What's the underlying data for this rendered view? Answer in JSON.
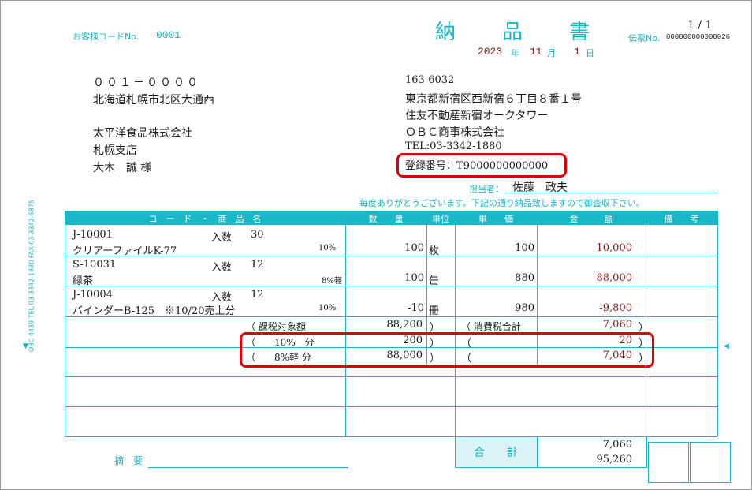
{
  "header": {
    "customer_code_label": "お客様コードNo.",
    "customer_code": "0001",
    "title_chars": [
      "納",
      "品",
      "書"
    ],
    "page": "1 / 1",
    "slip_label": "伝票No.",
    "slip_no": "000000000000026",
    "date_year": "2023",
    "date_year_unit": "年",
    "date_month": "11",
    "date_month_unit": "月",
    "date_day": "1",
    "date_day_unit": "日"
  },
  "recipient": {
    "zip": "００１－００００",
    "address": "北海道札幌市北区大通西",
    "company": "太平洋食品株式会社",
    "branch": "札幌支店",
    "person": "大木　誠 様"
  },
  "sender": {
    "zip": "163-6032",
    "address1": "東京都新宿区西新宿６丁目８番１号",
    "address2": "住友不動産新宿オークタワー",
    "company": "ＯＢＣ商事株式会社",
    "tel": "TEL:03-3342-1880",
    "registration": "登録番号：T9000000000000",
    "staff_label": "担当者：",
    "staff": "佐藤　政夫",
    "greeting": "毎度ありがとうございます。下記の通り納品致しますので御査収下さい。"
  },
  "table": {
    "headers": {
      "code_name": "コ　ー　ド　・　商　品　名",
      "qty": "数　　量",
      "unit": "単位",
      "price": "単　　価",
      "amount": "金　　　額",
      "note": "備　　考"
    },
    "items": [
      {
        "code": "J-10001",
        "qty_in_label": "入数",
        "qty_in": "30",
        "name": "クリアーファイルK-77",
        "tax": "10%",
        "qty": "100",
        "unit": "枚",
        "price": "100",
        "amount": "10,000"
      },
      {
        "code": "S-10031",
        "qty_in_label": "入数",
        "qty_in": "12",
        "name": "緑茶",
        "tax": "8%軽",
        "qty": "100",
        "unit": "缶",
        "price": "880",
        "amount": "88,000"
      },
      {
        "code": "J-10004",
        "qty_in_label": "入数",
        "qty_in": "12",
        "name": "バインダーB-125　※10/20売上分",
        "tax": "10%",
        "qty": "-10",
        "unit": "冊",
        "price": "980",
        "amount": "-9,800"
      }
    ],
    "summary": {
      "taxable_label": "（ 課税対象額",
      "taxable_value": "88,200",
      "tax_total_label": "（ 消費税合計",
      "tax_total_value": "7,060",
      "r10_label": "（　　10%　分",
      "r10_base": "200",
      "r10_tax": "20",
      "r8_label": "（　　8%軽 分",
      "r8_base": "88,000",
      "r8_tax": "7,040",
      "close_paren": "）",
      "open_paren": "（"
    }
  },
  "footer": {
    "memo_label": "摘　要",
    "total_label": "合　　計",
    "total_tax": "7,060",
    "grand_total": "95,260"
  },
  "side": {
    "left_text": "OBC 4439 TEL 03-3342-1880 FAX 03-3342-6875"
  }
}
